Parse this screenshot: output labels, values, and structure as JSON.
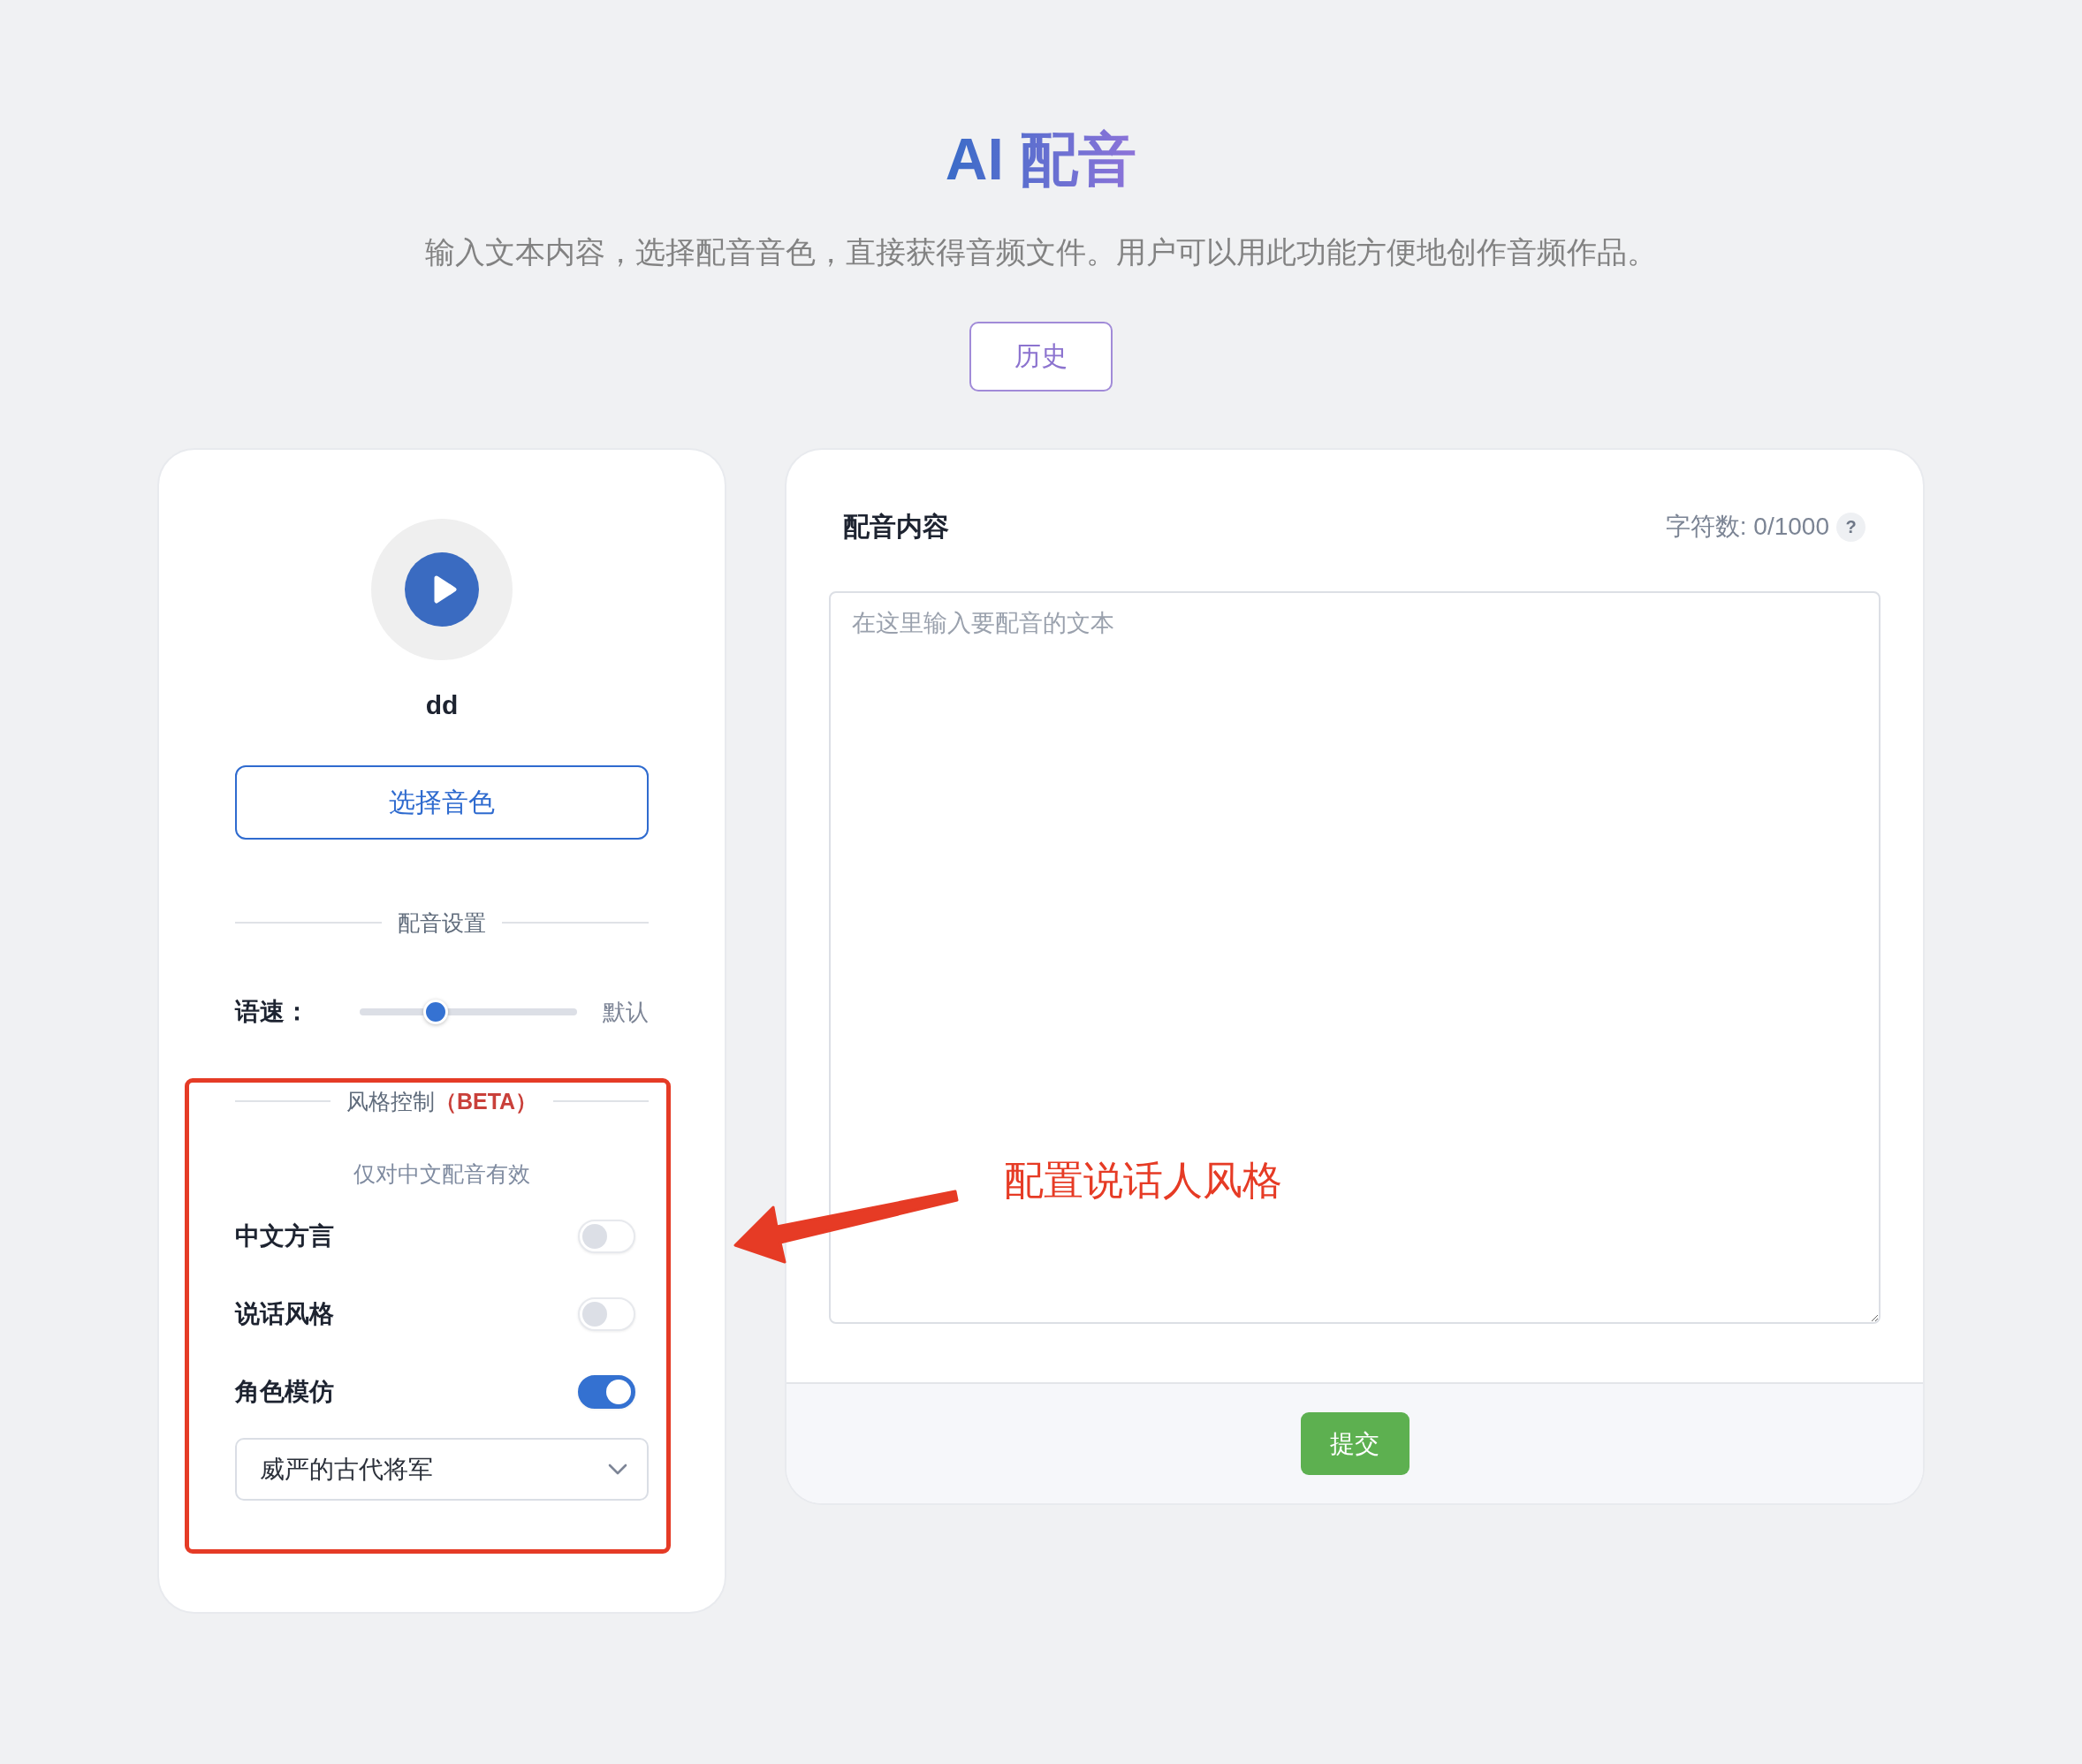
{
  "header": {
    "title": "AI 配音",
    "subtitle": "输入文本内容，选择配音音色，直接获得音频文件。用户可以用此功能方便地创作音频作品。",
    "history_button": "历史"
  },
  "voice_panel": {
    "voice_name": "dd",
    "select_button": "选择音色",
    "settings_divider": "配音设置",
    "speech_rate": {
      "label": "语速：",
      "level": 0.35,
      "reading": "默认"
    },
    "style_control": {
      "title": "风格控制",
      "tag": "（BETA）",
      "note": "仅对中文配音有效",
      "toggles": [
        {
          "label": "中文方言",
          "on": false
        },
        {
          "label": "说话风格",
          "on": false
        },
        {
          "label": "角色模仿",
          "on": true
        }
      ],
      "role_select": {
        "value": "威严的古代将军"
      }
    }
  },
  "content_panel": {
    "title": "配音内容",
    "char_count": "字符数: 0/1000",
    "help": "?",
    "text_input": {
      "placeholder": "在这里输入要配音的文本"
    },
    "submit_button": "提交"
  },
  "annotation": {
    "text": "配置说话人风格"
  }
}
